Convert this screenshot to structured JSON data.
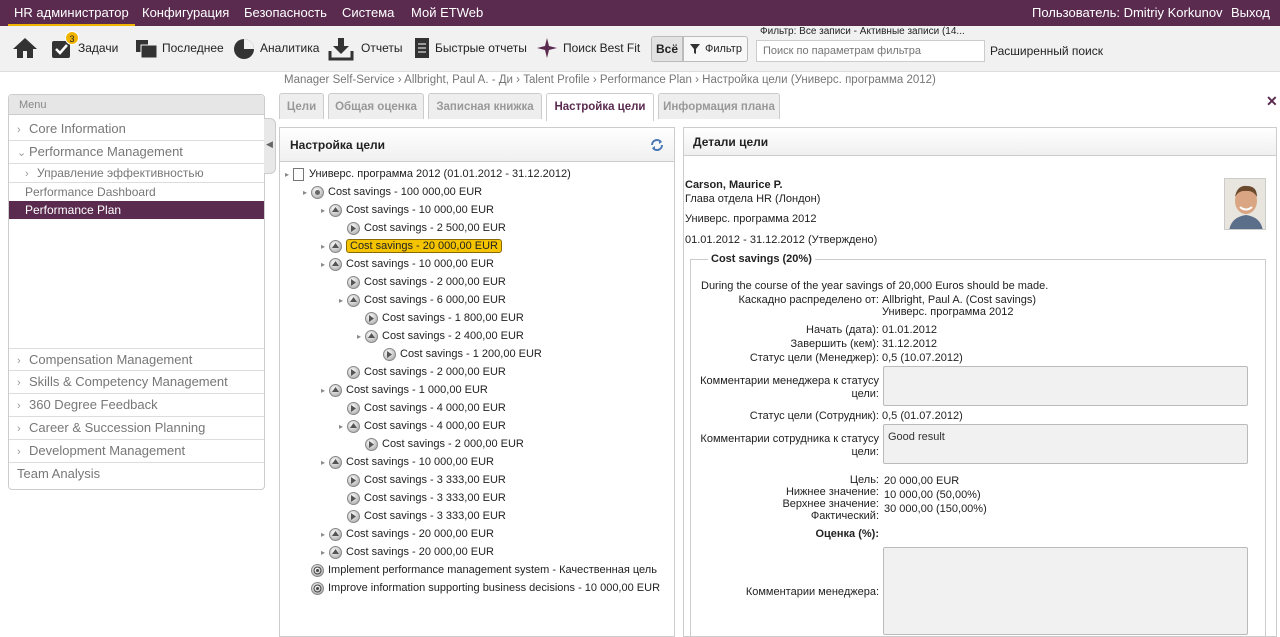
{
  "topbar": {
    "items": [
      "HR администратор",
      "Конфигурация",
      "Безопасность",
      "Система",
      "Мой ETWeb"
    ],
    "user": "Пользователь: Dmitriy Korkunov",
    "logout": "Выход"
  },
  "toolbar": {
    "home_icon": "home-icon",
    "tasks": "Задачи",
    "tasks_count": "3",
    "recent": "Последнее",
    "analytics": "Аналитика",
    "reports": "Отчеты",
    "quick_reports": "Быстрые отчеты",
    "best_fit": "Поиск Best Fit",
    "all": "Всё",
    "filter": "Фильтр",
    "filter_label": "Фильтр: Все записи - Активные записи (14...",
    "filter_placeholder": "Поиск по параметрам фильтра",
    "advanced_search": "Расширенный поиск"
  },
  "breadcrumb": "Manager Self-Service  ›  Allbright, Paul A. - Ди  ›  Talent Profile  ›  Performance Plan  ›  Настройка цели (Универс. программа 2012)",
  "menu": {
    "title": "Menu",
    "core": "Core Information",
    "perf": "Performance Management",
    "perf_sub": "Управление эффективностью",
    "dashboard": "Performance Dashboard",
    "plan": "Performance Plan",
    "comp": "Compensation Management",
    "skills": "Skills & Competency Management",
    "feedback": "360 Degree Feedback",
    "career": "Career & Succession Planning",
    "dev": "Development Management",
    "team": "Team Analysis"
  },
  "tabs": [
    "Цели",
    "Общая оценка",
    "Записная книжка",
    "Настройка цели",
    "Информация плана"
  ],
  "goal_panel": {
    "title": "Настройка цели",
    "nodes": [
      "Универс. программа 2012 (01.01.2012 - 31.12.2012)",
      "Cost savings - 100 000,00 EUR",
      "Cost savings - 10 000,00 EUR",
      "Cost savings - 2 500,00 EUR",
      "Cost savings - 20 000,00 EUR",
      "Cost savings - 10 000,00 EUR",
      "Cost savings - 2 000,00 EUR",
      "Cost savings - 6 000,00 EUR",
      "Cost savings - 1 800,00 EUR",
      "Cost savings - 2 400,00 EUR",
      "Cost savings - 1 200,00 EUR",
      "Cost savings - 2 000,00 EUR",
      "Cost savings - 1 000,00 EUR",
      "Cost savings - 4 000,00 EUR",
      "Cost savings - 4 000,00 EUR",
      "Cost savings - 2 000,00 EUR",
      "Cost savings - 10 000,00 EUR",
      "Cost savings - 3 333,00 EUR",
      "Cost savings - 3 333,00 EUR",
      "Cost savings - 3 333,00 EUR",
      "Cost savings - 20 000,00 EUR",
      "Cost savings - 20 000,00 EUR",
      "Implement performance management system - Качественная цель",
      "Improve information supporting business decisions - 10 000,00 EUR"
    ]
  },
  "detail": {
    "title": "Детали цели",
    "name": "Carson, Maurice P.",
    "position": "Глава отдела HR (Лондон)",
    "program": "Универс. программа 2012",
    "period": "01.01.2012 - 31.12.2012 (Утверждено)",
    "fieldset_title": "Cost savings (20%)",
    "description": "During the course of the year savings of 20,000 Euros should be made.",
    "cascade_label": "Каскадно распределено от:",
    "cascade_value": "Allbright, Paul A. (Cost savings)",
    "cascade_value2": "Универс. программа 2012",
    "start_label": "Начать (дата):",
    "start_value": "01.01.2012",
    "end_label": "Завершить (кем):",
    "end_value": "31.12.2012",
    "mgr_status_label": "Статус цели (Менеджер):",
    "mgr_status_value": "0,5 (10.07.2012)",
    "mgr_comment_label1": "Комментарии менеджера к статусу",
    "mgr_comment_label2": "цели:",
    "emp_status_label": "Статус цели (Сотрудник):",
    "emp_status_value": "0,5 (01.07.2012)",
    "emp_comment_label1": "Комментарии сотрудника к статусу",
    "emp_comment_label2": "цели:",
    "emp_comment_value": "Good result",
    "target_label": "Цель:",
    "target_value": "20 000,00  EUR",
    "low_label": "Нижнее значение:",
    "low_value": "10 000,00  (50,00%)",
    "high_label": "Верхнее значение:",
    "high_value": "30 000,00  (150,00%)",
    "actual_label": "Фактический:",
    "score_label": "Оценка (%):",
    "mgr_comments_label": "Комментарии менеджера:"
  },
  "colors": {
    "brand": "#5a2a4f",
    "accent": "#f0b400"
  }
}
